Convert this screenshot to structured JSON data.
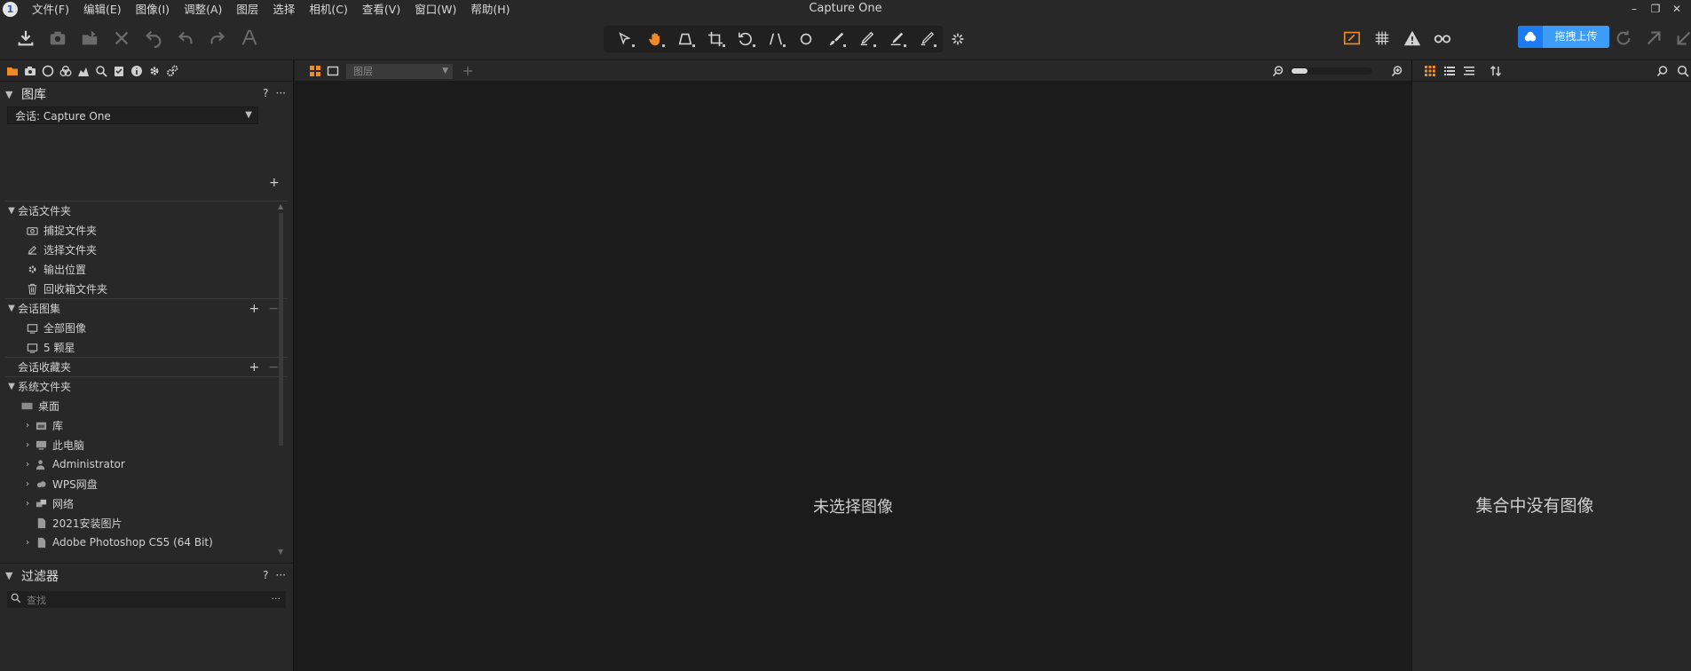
{
  "window": {
    "title": "Capture One",
    "logo_text": "1",
    "menu": [
      "文件(F)",
      "编辑(E)",
      "图像(I)",
      "调整(A)",
      "图层",
      "选择",
      "相机(C)",
      "查看(V)",
      "窗口(W)",
      "帮助(H)"
    ],
    "controls": [
      "minimize-icon",
      "restore-icon",
      "close-icon"
    ]
  },
  "toolbar": {
    "left_buttons": [
      {
        "name": "import-icon",
        "enabled": true
      },
      {
        "name": "capture-icon",
        "enabled": false
      },
      {
        "name": "move-to-folder-icon",
        "enabled": false
      },
      {
        "name": "delete-icon",
        "enabled": false
      },
      {
        "name": "reset-icon",
        "enabled": false
      },
      {
        "name": "undo-icon",
        "enabled": false
      },
      {
        "name": "redo-icon",
        "enabled": false
      },
      {
        "name": "text-icon",
        "enabled": false
      }
    ],
    "cursor_tools": [
      "select-cursor-icon",
      "pan-hand-icon",
      "keystone-icon",
      "crop-icon",
      "rotate-icon",
      "straighten-icon",
      "spot-removal-icon",
      "brush-icon",
      "draw-mask-icon",
      "erase-mask-icon",
      "gradient-mask-icon"
    ],
    "active_tool": "pan-hand-icon",
    "upload": {
      "label": "拖拽上传"
    }
  },
  "left_panel": {
    "tabs": [
      "library-tab",
      "capture-tab",
      "lens-tab",
      "color-tab",
      "exposure-tab",
      "details-tab",
      "adjustments-tab",
      "metadata-tab",
      "output-tab",
      "batch-tab"
    ],
    "library": {
      "title": "图库",
      "help": "?",
      "session_select": "会话: Capture One",
      "tree": [
        {
          "type": "group",
          "label": "会话文件夹",
          "expanded": true
        },
        {
          "type": "item",
          "icon": "capture-folder-icon",
          "label": "捕捉文件夹"
        },
        {
          "type": "item",
          "icon": "selects-folder-icon",
          "label": "选择文件夹"
        },
        {
          "type": "item",
          "icon": "output-location-icon",
          "label": "输出位置"
        },
        {
          "type": "item",
          "icon": "trash-icon",
          "label": "回收箱文件夹"
        },
        {
          "type": "group",
          "label": "会话图集",
          "expanded": true,
          "actions": true
        },
        {
          "type": "item",
          "icon": "album-icon",
          "label": "全部图像"
        },
        {
          "type": "item",
          "icon": "album-icon",
          "label": "5 颗星"
        },
        {
          "type": "group",
          "label": "会话收藏夹",
          "expanded": false,
          "actions": true
        },
        {
          "type": "group",
          "label": "系统文件夹",
          "expanded": true
        },
        {
          "type": "item",
          "icon": "desktop-icon",
          "label": "桌面",
          "indent": 0
        },
        {
          "type": "item",
          "icon": "library-folder-icon",
          "label": "库",
          "expandable": true
        },
        {
          "type": "item",
          "icon": "computer-icon",
          "label": "此电脑",
          "expandable": true
        },
        {
          "type": "item",
          "icon": "user-icon",
          "label": "Administrator",
          "expandable": true
        },
        {
          "type": "item",
          "icon": "cloud-drive-icon",
          "label": "WPS网盘",
          "expandable": true
        },
        {
          "type": "item",
          "icon": "network-icon",
          "label": "网络",
          "expandable": true
        },
        {
          "type": "item",
          "icon": "file-icon",
          "label": "2021安装图片"
        },
        {
          "type": "item",
          "icon": "file-icon",
          "label": "Adobe Photoshop CS5 (64 Bit)",
          "expandable": true
        }
      ]
    },
    "filters": {
      "title": "过滤器",
      "help": "?",
      "search_placeholder": "查找"
    }
  },
  "viewer": {
    "layer_select": "图层",
    "empty_text": "未选择图像"
  },
  "browser": {
    "empty_text": "集合中没有图像"
  },
  "colors": {
    "accent": "#f08a24",
    "panel_bg": "#282828",
    "viewer_bg": "#1b1b1b",
    "upload_blue": "#1a7cf0"
  }
}
